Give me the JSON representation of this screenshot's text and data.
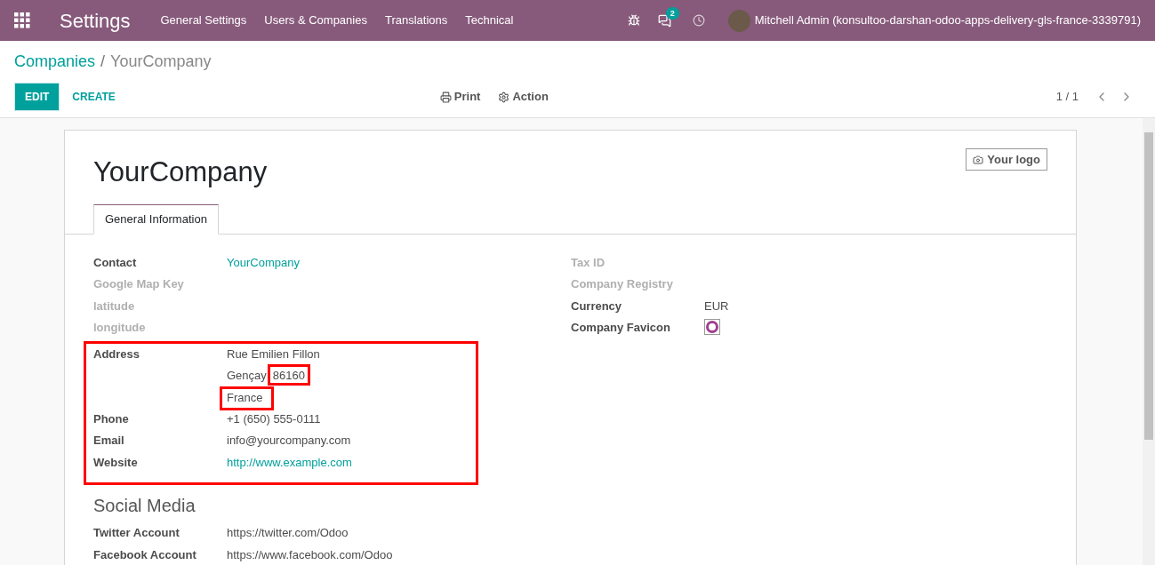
{
  "topbar": {
    "app_title": "Settings",
    "menu": [
      "General Settings",
      "Users & Companies",
      "Translations",
      "Technical"
    ],
    "messages_badge": "2",
    "user": "Mitchell Admin (konsultoo-darshan-odoo-apps-delivery-gls-france-3339791)"
  },
  "breadcrumb": {
    "parent": "Companies",
    "separator": "/",
    "current": "YourCompany"
  },
  "toolbar": {
    "edit": "EDIT",
    "create": "CREATE",
    "print": "Print",
    "action": "Action",
    "pager": "1 / 1"
  },
  "sheet": {
    "logo_button": "Your logo",
    "title": "YourCompany",
    "tabs": [
      {
        "label": "General Information",
        "selected": true
      }
    ],
    "left_fields": [
      {
        "label": "Contact",
        "value": "YourCompany",
        "kind": "link",
        "empty": false
      },
      {
        "label": "Google Map Key",
        "empty": true
      },
      {
        "label": "latitude",
        "empty": true
      },
      {
        "label": "longitude",
        "empty": true
      }
    ],
    "highlight_block": {
      "highlighted": true,
      "address": {
        "label": "Address",
        "street": "Rue Emilien Fillon",
        "city": "Gençay",
        "zip": "86160",
        "zip_highlighted": true,
        "country": "France",
        "country_highlighted": true
      },
      "fields": [
        {
          "label": "Phone",
          "value": "+1 (650) 555-0111",
          "kind": "text",
          "empty": false
        },
        {
          "label": "Email",
          "value": "info@yourcompany.com",
          "kind": "text",
          "empty": false
        },
        {
          "label": "Website",
          "value": "http://www.example.com",
          "kind": "link",
          "empty": false
        }
      ]
    },
    "right_fields": [
      {
        "label": "Tax ID",
        "empty": true
      },
      {
        "label": "Company Registry",
        "empty": true
      },
      {
        "label": "Currency",
        "value": "EUR",
        "kind": "text",
        "empty": false
      },
      {
        "label": "Company Favicon",
        "kind": "image",
        "empty": false
      }
    ],
    "social_title": "Social Media",
    "social_fields": [
      {
        "label": "Twitter Account",
        "value": "https://twitter.com/Odoo",
        "kind": "text",
        "empty": false
      },
      {
        "label": "Facebook Account",
        "value": "https://www.facebook.com/Odoo",
        "kind": "text",
        "empty": false
      }
    ]
  }
}
